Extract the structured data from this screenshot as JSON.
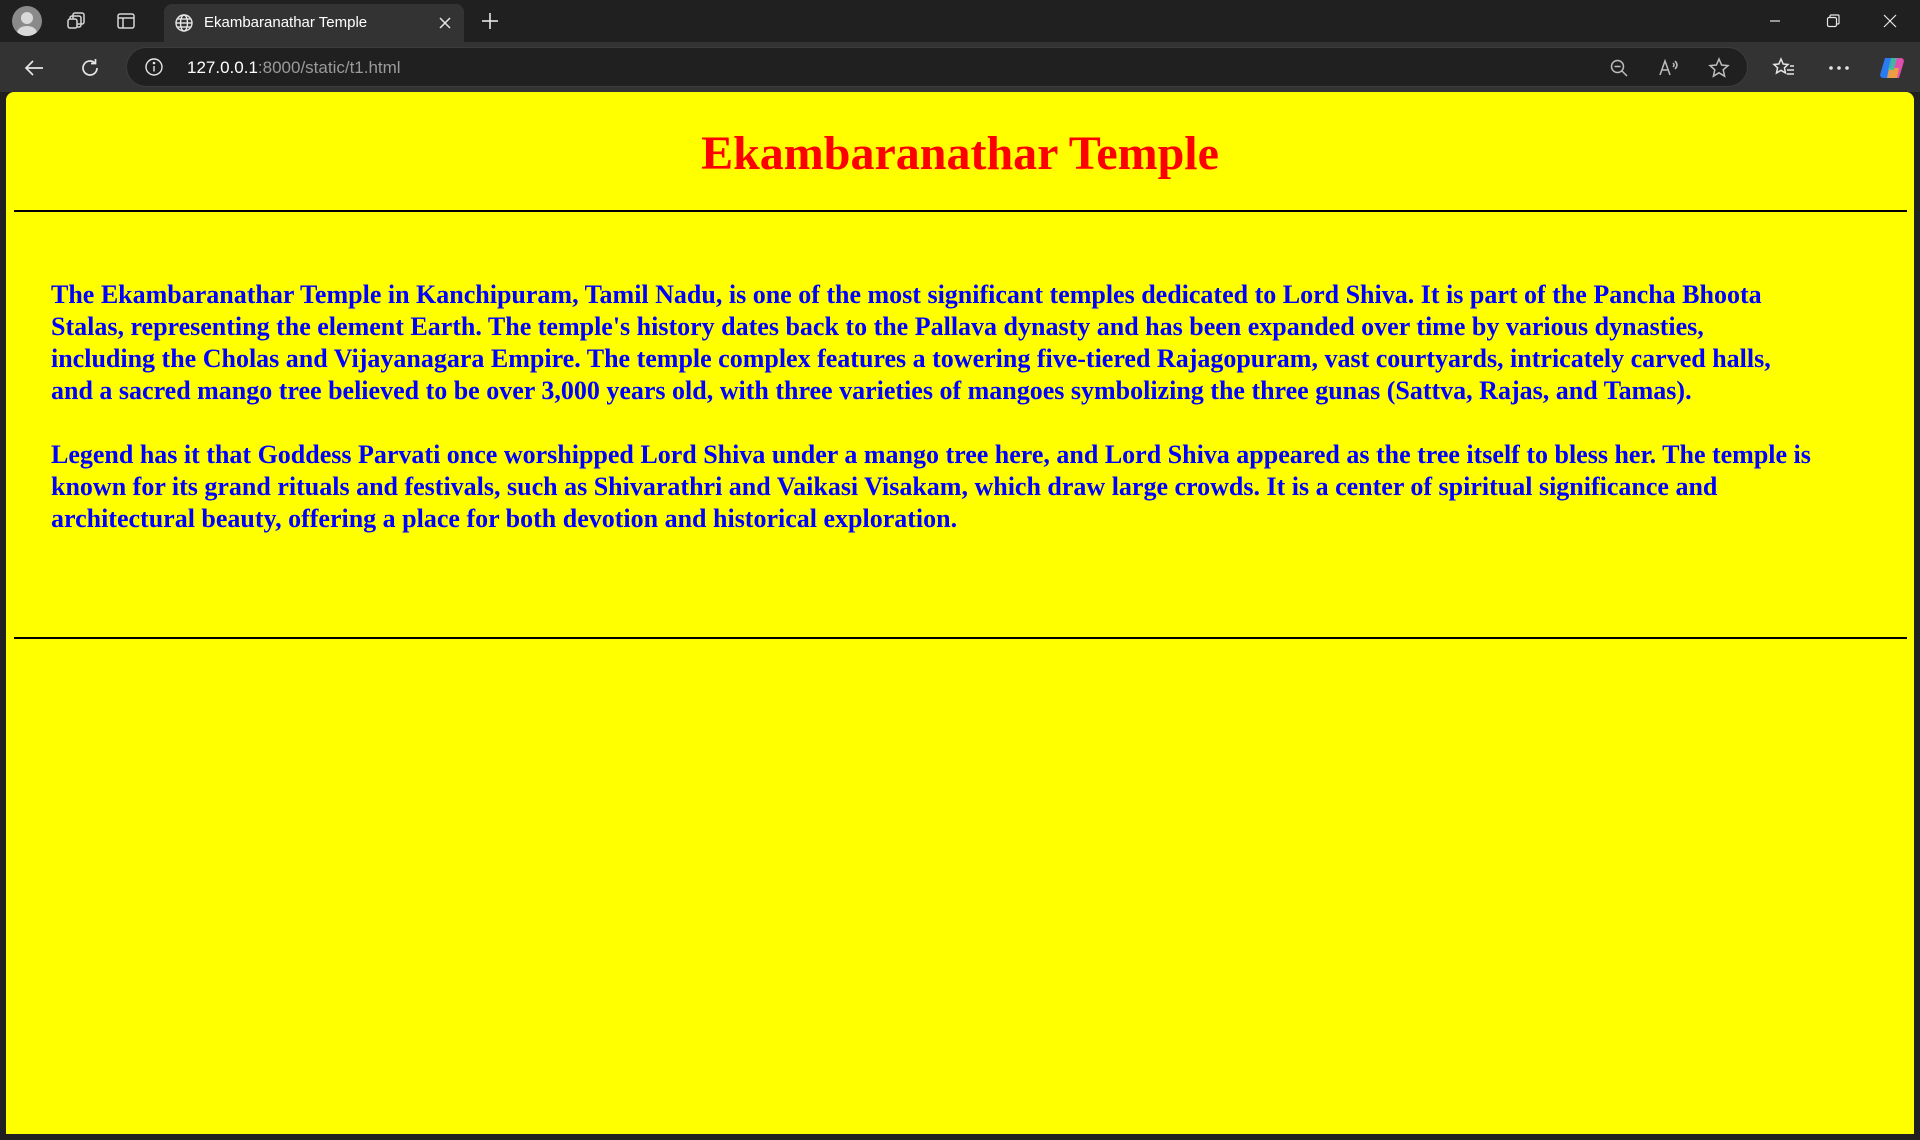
{
  "browser": {
    "tab": {
      "title": "Ekambaranathar Temple",
      "favicon": "globe-icon"
    },
    "address_bar": {
      "host": "127.0.0.1",
      "path": ":8000/static/t1.html"
    },
    "colors": {
      "chrome_dark": "#202020",
      "chrome_toolbar": "#333333"
    }
  },
  "page": {
    "title": "Ekambaranathar Temple",
    "paragraphs": [
      "The Ekambaranathar Temple in Kanchipuram, Tamil Nadu, is one of the most significant temples dedicated to Lord Shiva. It is part of the Pancha Bhoota Stalas, representing the element Earth. The temple's history dates back to the Pallava dynasty and has been expanded over time by various dynasties, including the Cholas and Vijayanagara Empire. The temple complex features a towering five-tiered Rajagopuram, vast courtyards, intricately carved halls, and a sacred mango tree believed to be over 3,000 years old, with three varieties of mangoes symbolizing the three gunas (Sattva, Rajas, and Tamas).",
      "Legend has it that Goddess Parvati once worshipped Lord Shiva under a mango tree here, and Lord Shiva appeared as the tree itself to bless her. The temple is known for its grand rituals and festivals, such as Shivarathri and Vaikasi Visakam, which draw large crowds. It is a center of spiritual significance and architectural beauty, offering a place for both devotion and historical exploration."
    ],
    "colors": {
      "background": "#ffff00",
      "title": "#ff0000",
      "body_text": "#0000ff",
      "rule": "#000000"
    }
  }
}
